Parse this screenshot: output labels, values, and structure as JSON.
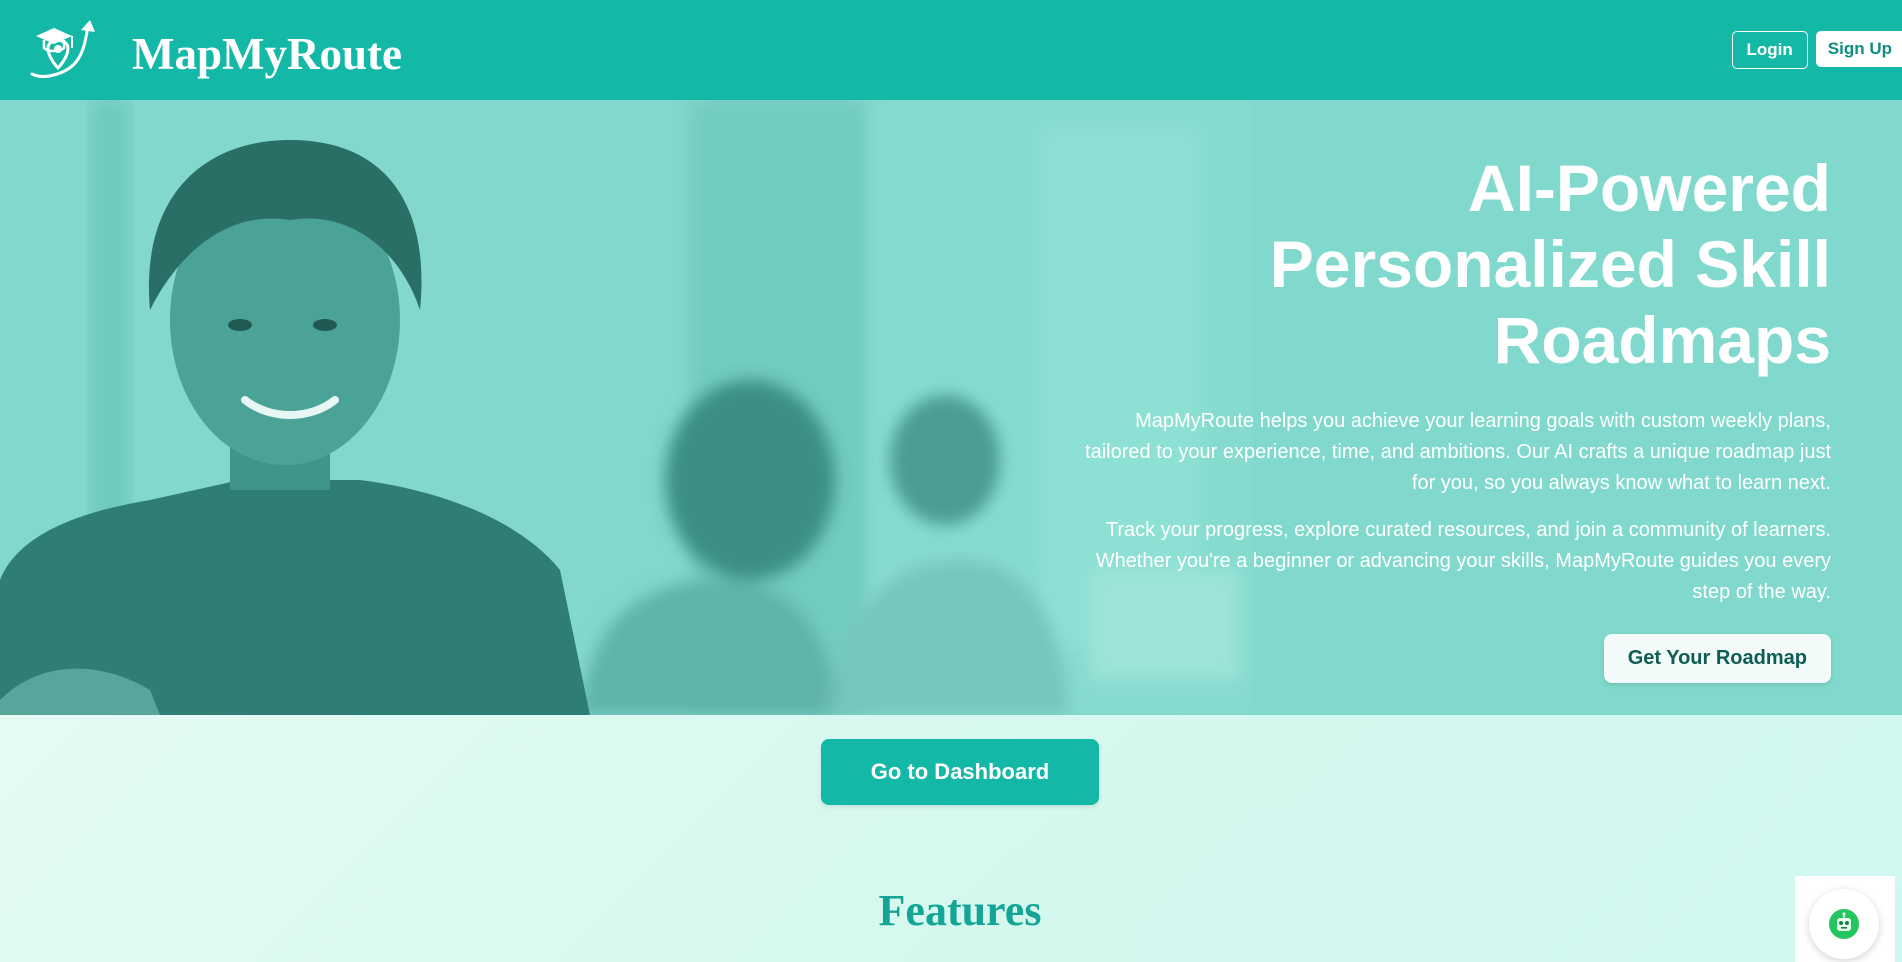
{
  "navbar": {
    "brand_name": "MapMyRoute",
    "login_label": "Login",
    "signup_label": "Sign Up"
  },
  "hero": {
    "title": "AI-Powered Personalized Skill Roadmaps",
    "paragraph_1": "MapMyRoute helps you achieve your learning goals with custom weekly plans, tailored to your experience, time, and ambitions. Our AI crafts a unique roadmap just for you, so you always know what to learn next.",
    "paragraph_2": "Track your progress, explore curated resources, and join a community of learners. Whether you're a beginner or advancing your skills, MapMyRoute guides you every step of the way.",
    "cta_label": "Get Your Roadmap"
  },
  "dashboard": {
    "button_label": "Go to Dashboard"
  },
  "features": {
    "heading": "Features"
  },
  "colors": {
    "brand": "#14b8a6",
    "hero_overlay": "#80d9cc",
    "features_heading": "#14a596",
    "cta_text": "#0e5d55"
  },
  "icons": {
    "logo": "graduation-cap-location-pin-icon",
    "chat": "robot-chat-icon"
  }
}
